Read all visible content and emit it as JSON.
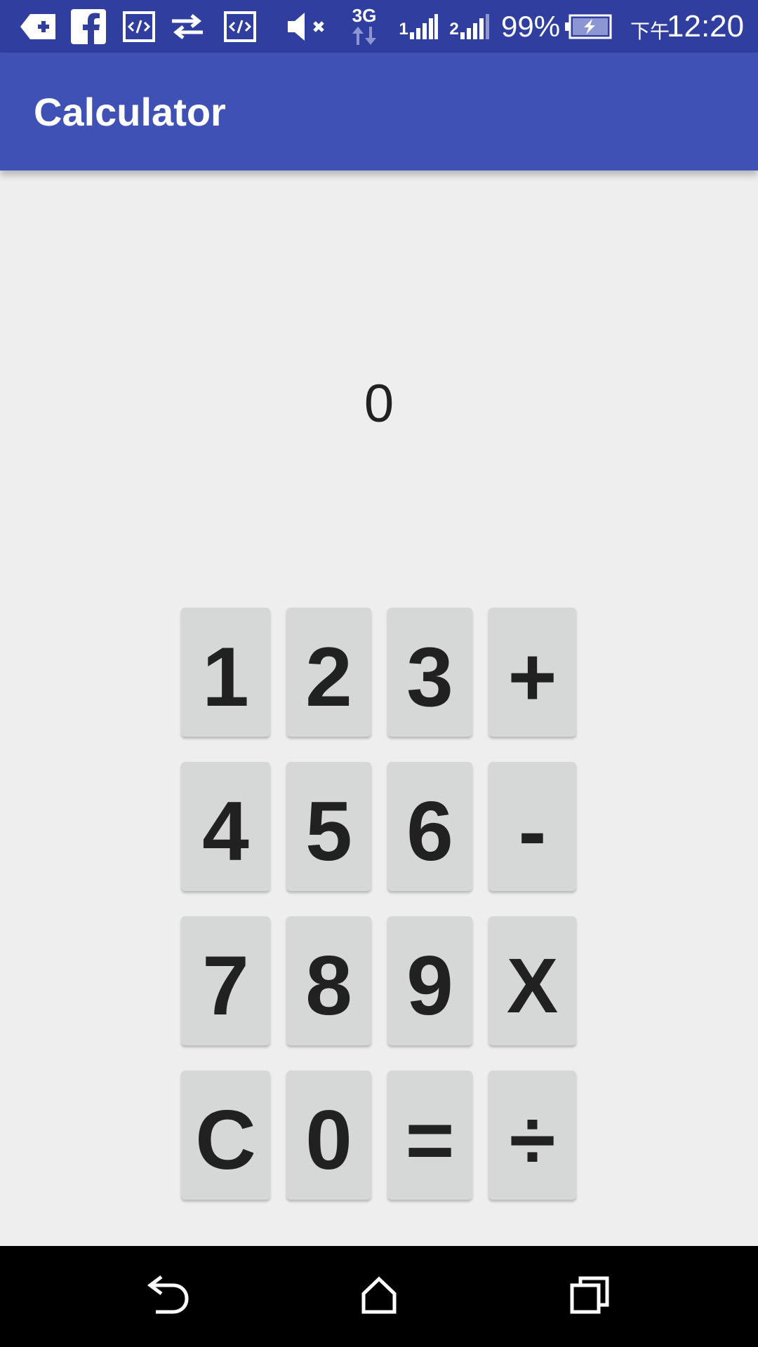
{
  "status_bar": {
    "battery_percent": "99%",
    "time_prefix": "下午",
    "time": "12:20",
    "network_type": "3G",
    "sim1_label": "1",
    "sim2_label": "2",
    "icons": [
      "app-add-icon",
      "facebook-icon",
      "code-icon",
      "sync-arrows-icon",
      "code-icon",
      "mute-icon",
      "network-3g-icon",
      "signal-icon",
      "signal-icon",
      "battery-charging-icon"
    ]
  },
  "app_bar": {
    "title": "Calculator"
  },
  "display": {
    "value": "0"
  },
  "keypad": {
    "rows": [
      [
        "1",
        "2",
        "3",
        "+"
      ],
      [
        "4",
        "5",
        "6",
        "-"
      ],
      [
        "7",
        "8",
        "9",
        "X"
      ],
      [
        "C",
        "0",
        "=",
        "÷"
      ]
    ]
  },
  "nav_bar": {
    "icons": [
      "back-icon",
      "home-icon",
      "recents-icon"
    ]
  },
  "colors": {
    "status_bar": "#303f9f",
    "app_bar": "#3f51b5",
    "background": "#eeeeee",
    "key_background": "#d6d7d7",
    "key_text": "#212121",
    "nav_bar": "#000000"
  }
}
